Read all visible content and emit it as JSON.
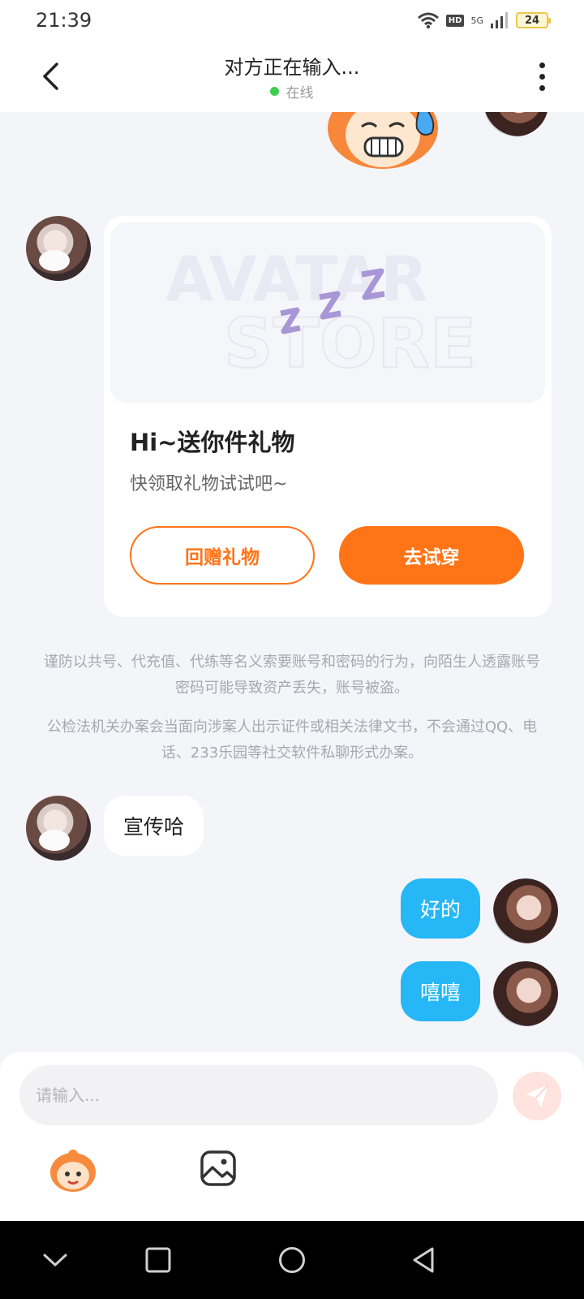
{
  "status_bar": {
    "time": "21:39",
    "hd": "HD",
    "network": "5G",
    "battery": "24"
  },
  "header": {
    "title": "对方正在输入...",
    "status": "在线",
    "online_color": "#3ccf4e"
  },
  "gift_card": {
    "banner_watermark_line1": "AVATAR",
    "banner_watermark_line2": "STORE",
    "title": "Hi~送你件礼物",
    "subtitle": "快领取礼物试试吧~",
    "return_label": "回赠礼物",
    "try_label": "去试穿"
  },
  "notices": [
    "谨防以共号、代充值、代练等名义索要账号和密码的行为，向陌生人透露账号密码可能导致资产丢失，账号被盗。",
    "公检法机关办案会当面向涉案人出示证件或相关法律文书，不会通过QQ、电话、233乐园等社交软件私聊形式办案。"
  ],
  "messages": [
    {
      "side": "in",
      "text": "宣传哈"
    },
    {
      "side": "out",
      "text": "好的"
    },
    {
      "side": "out",
      "text": "嘻嘻"
    }
  ],
  "input": {
    "placeholder": "请输入..."
  },
  "colors": {
    "accent": "#ff7417",
    "outgoing_bubble": "#25b7f6",
    "background": "#f4f5f9"
  }
}
